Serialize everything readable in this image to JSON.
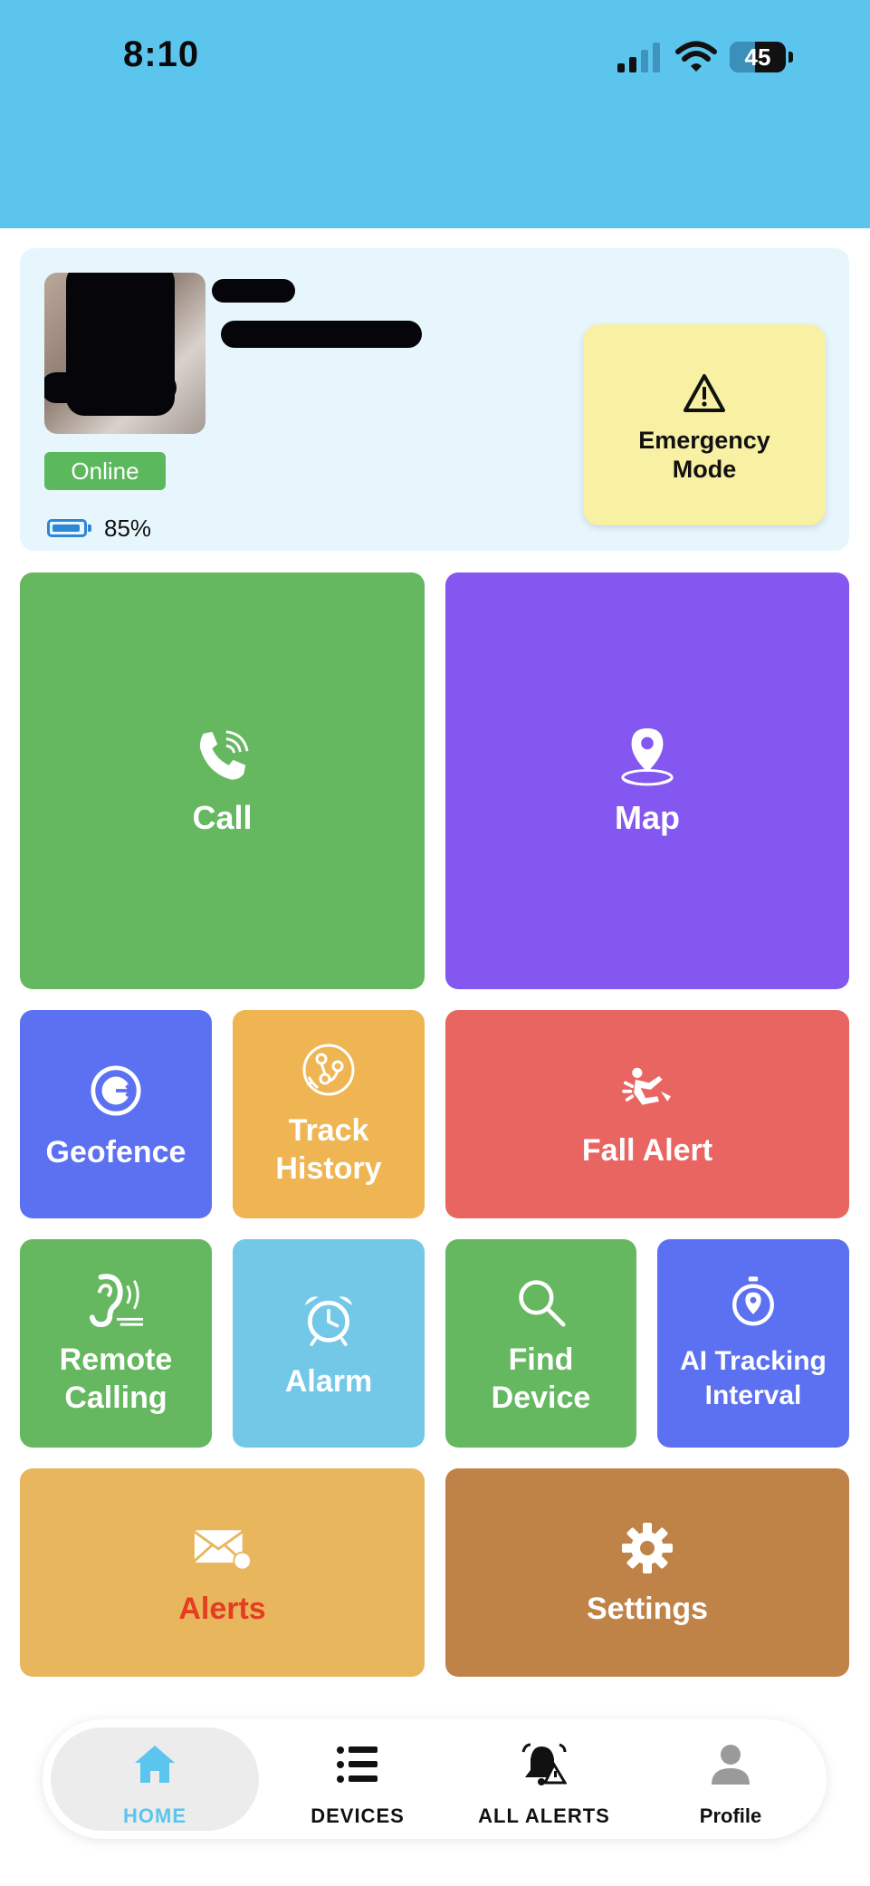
{
  "status_bar": {
    "time": "8:10",
    "battery": "45"
  },
  "device": {
    "status": "Online",
    "battery": "85%",
    "emergency_label": "Emergency\nMode"
  },
  "tiles": {
    "call": "Call",
    "map": "Map",
    "geofence": "Geofence",
    "track_history": "Track\nHistory",
    "fall_alert": "Fall Alert",
    "remote_calling": "Remote\nCalling",
    "alarm": "Alarm",
    "find_device": "Find\nDevice",
    "ai_tracking": "AI Tracking\nInterval",
    "alerts": "Alerts",
    "settings": "Settings"
  },
  "colors": {
    "header": "#5bc5ed",
    "green": "#65b760",
    "purple": "#8457f1",
    "blue": "#5b71f1",
    "orange": "#efb552",
    "red": "#e96561",
    "light_blue": "#73c8e8",
    "gold": "#e8b65c",
    "brown": "#c08347",
    "alerts_text": "#e53c22"
  },
  "nav": {
    "home": "HOME",
    "devices": "DEVICES",
    "all_alerts": "ALL ALERTS",
    "profile": "Profile"
  }
}
